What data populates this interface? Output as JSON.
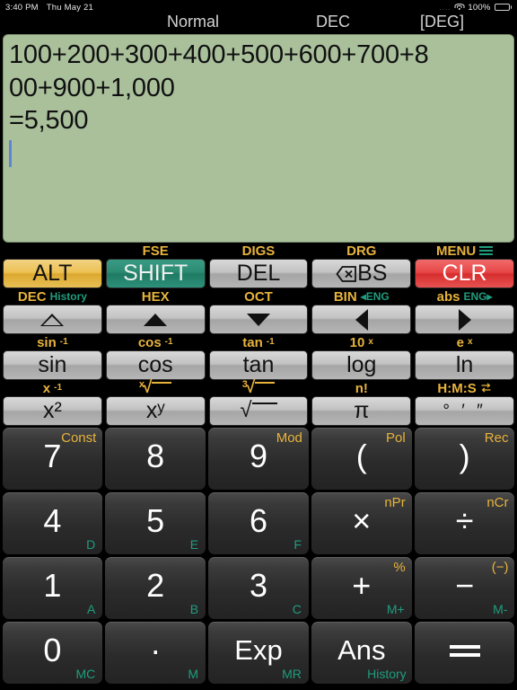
{
  "status_bar": {
    "time": "3:40 PM",
    "date": "Thu May 21",
    "signal_dots": "....",
    "battery_percent": "100%",
    "wifi_icon": "wifi-icon",
    "battery_icon": "battery-icon"
  },
  "header": {
    "mode": "Normal",
    "base": "DEC",
    "angle": "[DEG]"
  },
  "display": {
    "expression_line1": "100+200+300+400+500+600+700+8",
    "expression_line2": "00+900+1,000",
    "result": "=5,500",
    "background_color": "#a9c09b",
    "cursor_color": "#5f86d2"
  },
  "colors": {
    "alt_gold": "#e8b33c",
    "shift_teal": "#1f9d7e",
    "clr_red": "#e84747",
    "key_gray": "#c2c2c2",
    "keypad_dark": "#2b2b2b"
  },
  "function_rows": [
    {
      "row_name": "modifier-row",
      "keys": [
        {
          "top": "",
          "top2": "",
          "label": "ALT",
          "style": "alt",
          "name": "alt"
        },
        {
          "top": "FSE",
          "top2": "",
          "label": "SHIFT",
          "style": "shift",
          "name": "shift"
        },
        {
          "top": "DIGS",
          "top2": "",
          "label": "DEL",
          "style": "gray",
          "name": "del"
        },
        {
          "top": "DRG",
          "top2": "",
          "label": "BS",
          "style": "gray",
          "name": "backspace"
        },
        {
          "top": "MENU",
          "top2": "",
          "label": "CLR",
          "style": "clr",
          "name": "clr"
        }
      ]
    },
    {
      "row_name": "navigation-row",
      "keys": [
        {
          "top": "DEC",
          "top2": "History",
          "label": "",
          "style": "gray",
          "name": "up-hollow",
          "icon": "triangle-up-outline-icon"
        },
        {
          "top": "HEX",
          "top2": "",
          "label": "",
          "style": "gray",
          "name": "up",
          "icon": "triangle-up-icon"
        },
        {
          "top": "OCT",
          "top2": "",
          "label": "",
          "style": "gray",
          "name": "down",
          "icon": "triangle-down-icon"
        },
        {
          "top": "BIN",
          "top2": "◂ENG",
          "label": "",
          "style": "gray",
          "name": "left",
          "icon": "triangle-left-icon"
        },
        {
          "top": "abs",
          "top2": "ENG▸",
          "label": "",
          "style": "gray",
          "name": "right",
          "icon": "triangle-right-icon"
        }
      ]
    },
    {
      "row_name": "trig-row",
      "keys": [
        {
          "top": "sin",
          "top_sup": "-1",
          "label": "sin",
          "style": "gray",
          "name": "sin"
        },
        {
          "top": "cos",
          "top_sup": "-1",
          "label": "cos",
          "style": "gray",
          "name": "cos"
        },
        {
          "top": "tan",
          "top_sup": "-1",
          "label": "tan",
          "style": "gray",
          "name": "tan"
        },
        {
          "top": "10",
          "top_sup": "x",
          "label": "log",
          "style": "gray",
          "name": "log"
        },
        {
          "top": "e",
          "top_sup": "x",
          "label": "ln",
          "style": "gray",
          "name": "ln"
        }
      ]
    },
    {
      "row_name": "power-row",
      "keys": [
        {
          "top": "x",
          "top_sup": "-1",
          "label": "x²",
          "style": "gray",
          "name": "x-squared"
        },
        {
          "top": "ˣ√",
          "top_sup": "",
          "label": "xʸ",
          "style": "gray",
          "name": "x-power-y"
        },
        {
          "top": "³√",
          "top_sup": "",
          "label": "√",
          "style": "gray",
          "name": "square-root"
        },
        {
          "top": "n!",
          "top_sup": "",
          "label": "π",
          "style": "gray",
          "name": "pi"
        },
        {
          "top": "H:M:S",
          "top_sup": "",
          "label": "° ′ ″",
          "style": "gray",
          "name": "degrees-minutes-seconds"
        }
      ]
    }
  ],
  "keypad_rows": [
    {
      "row_name": "row-789",
      "keys": [
        {
          "main": "7",
          "top_right": "Const",
          "bottom_right": "",
          "name": "seven"
        },
        {
          "main": "8",
          "top_right": "",
          "bottom_right": "",
          "name": "eight"
        },
        {
          "main": "9",
          "top_right": "Mod",
          "bottom_right": "",
          "name": "nine"
        },
        {
          "main": "(",
          "top_right": "Pol",
          "bottom_right": "",
          "name": "open-paren"
        },
        {
          "main": ")",
          "top_right": "Rec",
          "bottom_right": "",
          "name": "close-paren"
        }
      ]
    },
    {
      "row_name": "row-456",
      "keys": [
        {
          "main": "4",
          "top_right": "",
          "bottom_right": "D",
          "name": "four"
        },
        {
          "main": "5",
          "top_right": "",
          "bottom_right": "E",
          "name": "five"
        },
        {
          "main": "6",
          "top_right": "",
          "bottom_right": "F",
          "name": "six"
        },
        {
          "main": "×",
          "top_right": "nPr",
          "bottom_right": "",
          "name": "multiply"
        },
        {
          "main": "÷",
          "top_right": "nCr",
          "bottom_right": "",
          "name": "divide"
        }
      ]
    },
    {
      "row_name": "row-123",
      "keys": [
        {
          "main": "1",
          "top_right": "",
          "bottom_right": "A",
          "name": "one"
        },
        {
          "main": "2",
          "top_right": "",
          "bottom_right": "B",
          "name": "two"
        },
        {
          "main": "3",
          "top_right": "",
          "bottom_right": "C",
          "name": "three"
        },
        {
          "main": "+",
          "top_right": "%",
          "bottom_right": "M+",
          "name": "plus"
        },
        {
          "main": "−",
          "top_right": "(−)",
          "bottom_right": "M-",
          "name": "minus"
        }
      ]
    },
    {
      "row_name": "row-0",
      "keys": [
        {
          "main": "0",
          "top_right": "",
          "bottom_right": "MC",
          "name": "zero"
        },
        {
          "main": "·",
          "top_right": "",
          "bottom_right": "M",
          "name": "decimal-point"
        },
        {
          "main": "Exp",
          "top_right": "",
          "bottom_right": "MR",
          "name": "exponent"
        },
        {
          "main": "Ans",
          "top_right": "",
          "bottom_right": "History",
          "name": "answer"
        },
        {
          "main": "=",
          "top_right": "",
          "bottom_right": "",
          "name": "equals"
        }
      ]
    }
  ]
}
